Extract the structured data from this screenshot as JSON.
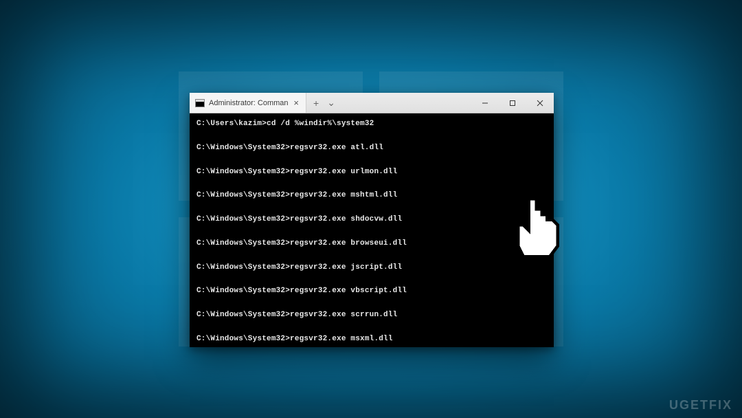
{
  "window": {
    "tab_title": "Administrator: Command Prom",
    "tab_close_glyph": "×",
    "new_tab_glyph": "+",
    "dropdown_glyph": "⌄"
  },
  "terminal": {
    "lines": [
      "C:\\Users\\kazim>cd /d %windir%\\system32",
      "C:\\Windows\\System32>regsvr32.exe atl.dll",
      "C:\\Windows\\System32>regsvr32.exe urlmon.dll",
      "C:\\Windows\\System32>regsvr32.exe mshtml.dll",
      "C:\\Windows\\System32>regsvr32.exe shdocvw.dll",
      "C:\\Windows\\System32>regsvr32.exe browseui.dll",
      "C:\\Windows\\System32>regsvr32.exe jscript.dll",
      "C:\\Windows\\System32>regsvr32.exe vbscript.dll",
      "C:\\Windows\\System32>regsvr32.exe scrrun.dll",
      "C:\\Windows\\System32>regsvr32.exe msxml.dll"
    ]
  },
  "watermark": "UGETFIX"
}
